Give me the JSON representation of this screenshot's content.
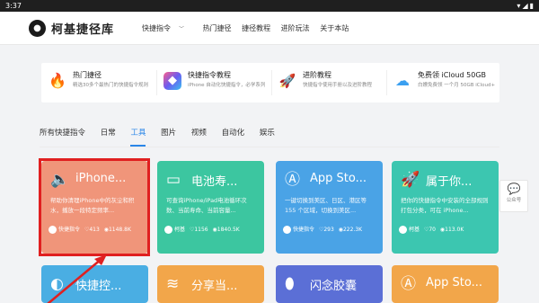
{
  "status": {
    "time": "3:37",
    "icons": "▾◢▮"
  },
  "header": {
    "logo_glyph": "●",
    "brand": "柯基捷径库",
    "nav": [
      "快捷指令",
      "热门捷径",
      "捷径教程",
      "进阶玩法",
      "关于本站"
    ]
  },
  "promos": [
    {
      "icon": "flame-icon",
      "title": "热门捷径",
      "desc": "精选30多个最热门的快捷指令规则",
      "color": "#ff6a2e"
    },
    {
      "icon": "shortcuts-app-icon",
      "title": "快捷指令教程",
      "desc": "iPhone 自动化快捷指令，必学系列",
      "color": "#7b5cf0"
    },
    {
      "icon": "rocket-icon",
      "title": "进阶教程",
      "desc": "快捷指令使用手册以及进阶教程",
      "color": "#e8e8e8"
    },
    {
      "icon": "cloud-icon",
      "title": "免费领 iCloud 50GB",
      "desc": "白嫖免费领 一个月 50GB iCloud+",
      "color": "#3a9ff0"
    }
  ],
  "tabs": [
    "所有快捷指令",
    "日常",
    "工具",
    "图片",
    "视频",
    "自动化",
    "娱乐"
  ],
  "active_tab": "工具",
  "cards": [
    {
      "title": "iPhone...",
      "desc": "帮助你清理iPhone中的灰尘和积水，播放一段特定频率...",
      "author": "快捷指令",
      "likes": "413",
      "views": "1148.8K",
      "color": "#f0957a",
      "icon": "speaker-icon"
    },
    {
      "title": "电池寿...",
      "desc": "可查询iPhone/iPad电池循环次数、当前寿命、当前容量...",
      "author": "柯基",
      "likes": "1156",
      "views": "1840.5K",
      "color": "#3cc6a0",
      "icon": "battery-icon"
    },
    {
      "title": "App Sto...",
      "desc": "一键切换到美区、日区、港区等 155 个区域，切换到美区...",
      "author": "快捷指令",
      "likes": "293",
      "views": "222.3K",
      "color": "#4aa3e6",
      "icon": "appstore-icon"
    },
    {
      "title": "属于你...",
      "desc": "把你的快捷指令中安装的全部规则打包分类，可在 iPhone...",
      "author": "柯基",
      "likes": "70",
      "views": "113.0K",
      "color": "#3cc6b0",
      "icon": "rocket-icon"
    },
    {
      "title": "快捷控...",
      "desc": "",
      "author": "",
      "likes": "",
      "views": "",
      "color": "#4aaee3",
      "icon": "control-icon"
    },
    {
      "title": "分享当...",
      "desc": "",
      "author": "",
      "likes": "",
      "views": "",
      "color": "#f2a64a",
      "icon": "wifi-icon"
    },
    {
      "title": "闪念胶囊",
      "desc": "",
      "author": "",
      "likes": "",
      "views": "",
      "color": "#5b6fd6",
      "icon": "capsule-icon"
    },
    {
      "title": "App Sto...",
      "desc": "",
      "author": "",
      "likes": "",
      "views": "",
      "color": "#f2a64a",
      "icon": "appstore-icon"
    }
  ],
  "side_widget": {
    "label": "公众号"
  }
}
